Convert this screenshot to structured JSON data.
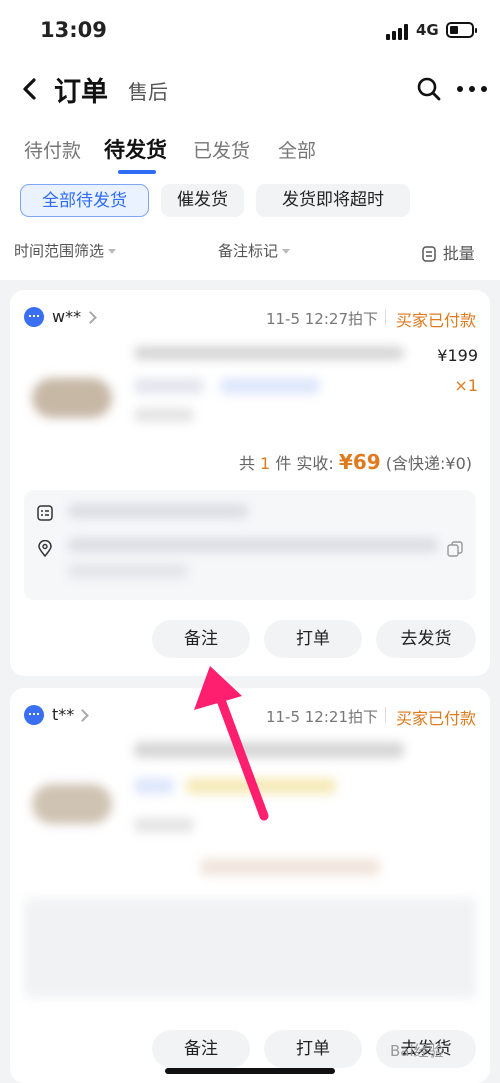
{
  "status_bar": {
    "time": "13:09",
    "network": "4G"
  },
  "nav": {
    "title": "订单",
    "subtitle": "售后"
  },
  "tabs": [
    {
      "label": "待付款",
      "active": false
    },
    {
      "label": "待发货",
      "active": true
    },
    {
      "label": "已发货",
      "active": false
    },
    {
      "label": "全部",
      "active": false
    }
  ],
  "chips": [
    {
      "label": "全部待发货",
      "active": true
    },
    {
      "label": "催发货",
      "active": false
    },
    {
      "label": "发货即将超时",
      "active": false
    }
  ],
  "filters": {
    "time_range": "时间范围筛选",
    "remark_flag": "备注标记",
    "batch": "批量"
  },
  "orders": [
    {
      "buyer": "w**",
      "time": "11-5 12:27拍下",
      "status": "买家已付款",
      "price": "¥199",
      "qty": "×1",
      "summary": {
        "prefix": "共",
        "count": "1",
        "suffix_count": "件 实收:",
        "amount": "¥69",
        "shipping": "(含快递:¥0)"
      },
      "actions": [
        "备注",
        "打单",
        "去发货"
      ]
    },
    {
      "buyer": "t**",
      "time": "11-5 12:21拍下",
      "status": "买家已付款",
      "actions": [
        "备注",
        "打单",
        "去发货"
      ]
    }
  ],
  "watermark": "Bai经验",
  "colors": {
    "accent": "#2e6cf6",
    "status_orange": "#e07a1f",
    "arrow": "#ff1f6e"
  }
}
